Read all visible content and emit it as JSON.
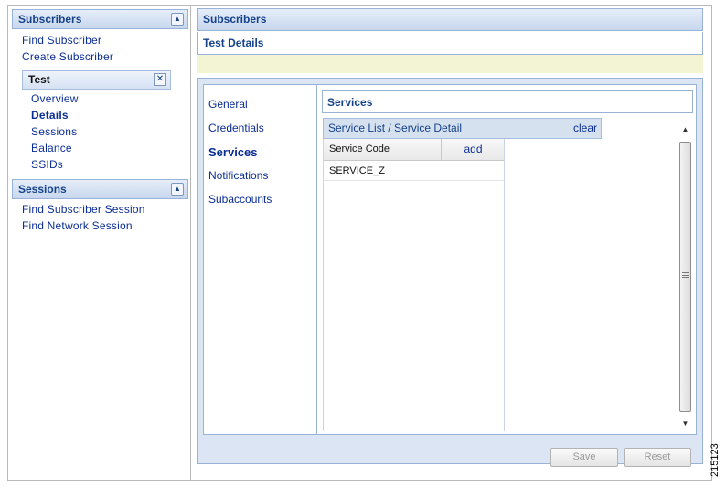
{
  "sidebar": {
    "subscribers_section": {
      "title": "Subscribers",
      "links": [
        "Find Subscriber",
        "Create Subscriber"
      ]
    },
    "subscriber_panel": {
      "title": "Test",
      "links": [
        "Overview",
        "Details",
        "Sessions",
        "Balance",
        "SSIDs"
      ],
      "active": "Details"
    },
    "sessions_section": {
      "title": "Sessions",
      "links": [
        "Find Subscriber Session",
        "Find Network Session"
      ]
    }
  },
  "main": {
    "header": "Subscribers",
    "page_title": "Test Details",
    "tabs": [
      "General",
      "Credentials",
      "Services",
      "Notifications",
      "Subaccounts"
    ],
    "active_tab": "Services",
    "services": {
      "title": "Services",
      "list_header": "Service List / Service Detail",
      "clear_label": "clear",
      "columns": {
        "code": "Service Code",
        "add": "add"
      },
      "rows": [
        "SERVICE_Z"
      ]
    },
    "buttons": {
      "save": "Save",
      "reset": "Reset"
    }
  },
  "figure_id": "215123"
}
